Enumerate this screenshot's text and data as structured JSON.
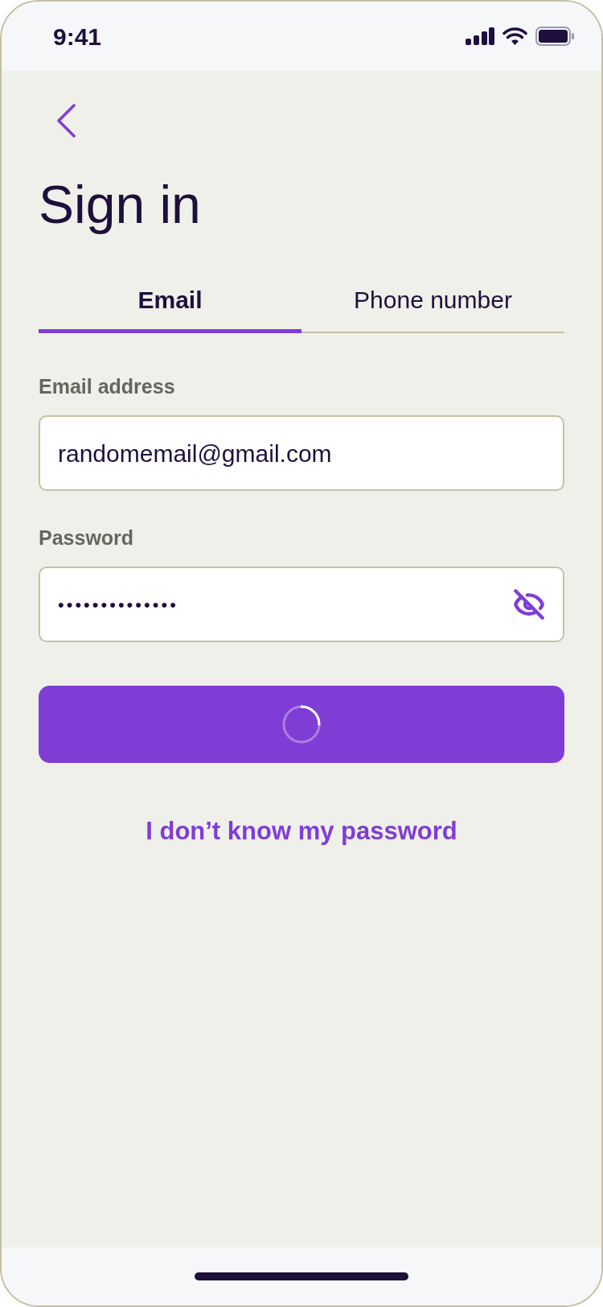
{
  "status_bar": {
    "time": "9:41"
  },
  "title": "Sign in",
  "tabs": [
    {
      "label": "Email",
      "selected": true
    },
    {
      "label": "Phone number",
      "selected": false
    }
  ],
  "fields": [
    {
      "label": "Email address",
      "value": "randomemail@gmail.com",
      "kind": "text"
    },
    {
      "label": "Password",
      "value": "••••••••••••••",
      "kind": "password",
      "revealed": false
    }
  ],
  "submit_button": {
    "loading": true
  },
  "forgot_link": "I don’t know my password"
}
